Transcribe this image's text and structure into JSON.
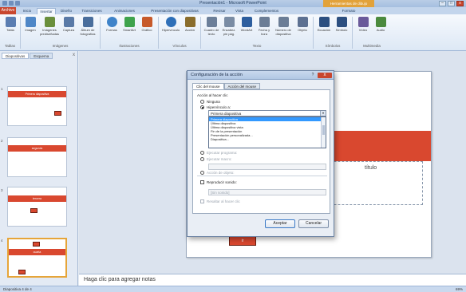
{
  "app": {
    "window_title": "Presentación1 - Microsoft PowerPoint",
    "context_tab": "Herramientas de dibujo",
    "window_controls": [
      "–",
      "□",
      "x"
    ]
  },
  "ribbon_tabs": [
    {
      "label": "Inicio",
      "active": false
    },
    {
      "label": "Insertar",
      "active": true
    },
    {
      "label": "Diseño",
      "active": false
    },
    {
      "label": "Transiciones",
      "active": false
    },
    {
      "label": "Animaciones",
      "active": false
    },
    {
      "label": "Presentación con diapositivas",
      "active": false
    },
    {
      "label": "Revisar",
      "active": false
    },
    {
      "label": "Vista",
      "active": false
    },
    {
      "label": "Complementos",
      "active": false
    },
    {
      "label": "Formato",
      "active": false
    }
  ],
  "file_tab": "Archivo",
  "ribbon_buttons": [
    {
      "label": "Tabla",
      "icon": "table-icon",
      "color": "#5b7db1"
    },
    {
      "label": "Imagen",
      "icon": "image-icon",
      "color": "#4f87c7"
    },
    {
      "label": "Imágenes prediseñadas",
      "icon": "clipart-icon",
      "color": "#6a8f3c"
    },
    {
      "label": "Captura",
      "icon": "screenshot-icon",
      "color": "#5a7aa7"
    },
    {
      "label": "Álbum de fotografías",
      "icon": "album-icon",
      "color": "#4a6e9c"
    },
    {
      "label": "Formas",
      "icon": "shapes-icon",
      "color": "#3f83c9"
    },
    {
      "label": "SmartArt",
      "icon": "smartart-icon",
      "color": "#3fa34d"
    },
    {
      "label": "Gráfico",
      "icon": "chart-icon",
      "color": "#c75a2b"
    },
    {
      "label": "Hipervínculo",
      "icon": "hyperlink-icon",
      "color": "#2e6fb8"
    },
    {
      "label": "Acción",
      "icon": "action-icon",
      "color": "#8a6d2c"
    },
    {
      "label": "Cuadro de texto",
      "icon": "textbox-icon",
      "color": "#6c7f99"
    },
    {
      "label": "Encabez. pie pág.",
      "icon": "header-footer-icon",
      "color": "#7a8ca4"
    },
    {
      "label": "WordArt",
      "icon": "wordart-icon",
      "color": "#2d5e9e"
    },
    {
      "label": "Fecha y hora",
      "icon": "datetime-icon",
      "color": "#6b7d96"
    },
    {
      "label": "Número de diapositiva",
      "icon": "slide-number-icon",
      "color": "#6b7d96"
    },
    {
      "label": "Objeto",
      "icon": "object-icon",
      "color": "#5d7192"
    },
    {
      "label": "Ecuación",
      "icon": "equation-icon",
      "color": "#2c4f80"
    },
    {
      "label": "Símbolo",
      "icon": "symbol-icon",
      "color": "#2c4f80"
    },
    {
      "label": "Vídeo",
      "icon": "video-icon",
      "color": "#6a5a9a"
    },
    {
      "label": "Audio",
      "icon": "audio-icon",
      "color": "#4b8a3e"
    }
  ],
  "ribbon_groups": [
    "Tablas",
    "Imágenes",
    "Ilustraciones",
    "Vínculos",
    "Texto",
    "Símbolos",
    "Multimedia"
  ],
  "left_panel": {
    "tabs": [
      "Diapositivas",
      "Esquema"
    ],
    "close_glyph": "x",
    "thumbnails": [
      {
        "number": "1",
        "band_text": "Primera diapositiva",
        "selected": false
      },
      {
        "number": "2",
        "band_text": "segunda",
        "selected": false
      },
      {
        "number": "3",
        "band_text": "tercera",
        "selected": false
      },
      {
        "number": "4",
        "band_text": "cuarta",
        "selected": true
      }
    ]
  },
  "slide": {
    "placeholder_text": "título",
    "button_label": "ir"
  },
  "notes_placeholder": "Haga clic para agregar notas",
  "status": {
    "left": "Diapositiva 4 de 4",
    "zoom": "69%"
  },
  "dialog": {
    "title": "Configuración de la acción",
    "help_glyph": "?",
    "close_glyph": "x",
    "tabs": [
      {
        "label": "Clic del mouse",
        "active": true
      },
      {
        "label": "Acción del mouse",
        "active": false
      }
    ],
    "group_label": "Acción al hacer clic",
    "radio_none": "Ninguna",
    "radio_hyperlink": "Hipervínculo a:",
    "combo_value": "Primera diapositiva",
    "combo_arrow": "▾",
    "dropdown_items": [
      "Primera diapositiva",
      "Última diapositiva",
      "Última diapositiva vista",
      "Fin de la presentación",
      "Presentación personalizada...",
      "Diapositiva..."
    ],
    "dropdown_selected_index": 0,
    "run_program": "Ejecutar programa:",
    "run_macro": "Ejecutar macro:",
    "object_action": "Acción de objeto:",
    "play_sound": "Reproducir sonido:",
    "sound_value": "[Sin sonido]",
    "highlight_click": "Resaltar al hacer clic",
    "ok_label": "Aceptar",
    "cancel_label": "Cancelar"
  }
}
